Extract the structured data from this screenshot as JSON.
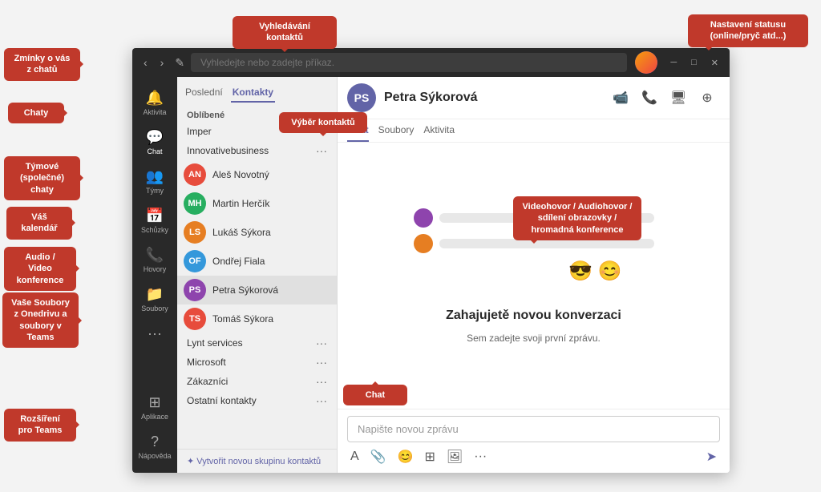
{
  "annotations": {
    "zmínky": "Zmínky o vás z chatů",
    "chaty": "Chaty",
    "tymy": "Týmové (společné) chaty",
    "kalendar": "Váš kalendář",
    "audio": "Audio / Video konference",
    "soubory": "Vaše Soubory z Onedrivu a soubory v Teams",
    "rozsireni": "Rozšíření pro Teams",
    "vyhledavani": "Vyhledávání kontaktů",
    "nastaveni": "Nastavení statusu (online/pryč atd...)",
    "vyber": "Výběr kontaktů",
    "video": "Videohovor / Audiohovor / sdílení obrazovky / hromadná konference",
    "chat_label": "Chat"
  },
  "titlebar": {
    "search_placeholder": "Vyhledejte nebo zadejte příkaz.",
    "nav_back": "‹",
    "nav_forward": "›",
    "compose_icon": "✎"
  },
  "sidebar": {
    "items": [
      {
        "label": "Aktivita",
        "icon": "🔔",
        "active": false
      },
      {
        "label": "Chat",
        "icon": "💬",
        "active": true
      },
      {
        "label": "Týmy",
        "icon": "👥",
        "active": false
      },
      {
        "label": "Schůzky",
        "icon": "📅",
        "active": false
      },
      {
        "label": "Hovory",
        "icon": "📞",
        "active": false
      },
      {
        "label": "Soubory",
        "icon": "📁",
        "active": false
      },
      {
        "label": "···",
        "icon": "···",
        "active": false
      }
    ],
    "bottom_items": [
      {
        "label": "Aplikace",
        "icon": "⊞"
      },
      {
        "label": "Nápověda",
        "icon": "?"
      }
    ]
  },
  "contact_panel": {
    "tabs": [
      "Poslední",
      "Kontakty"
    ],
    "active_tab": "Kontakty",
    "groups": [
      {
        "name": "Oblíbené",
        "has_dots": false,
        "contacts": []
      },
      {
        "name": "Imper",
        "has_dots": true,
        "contacts": []
      },
      {
        "name": "Innovativebusiness",
        "has_dots": true,
        "contacts": [
          {
            "name": "Aleš Novotný",
            "color": "#e74c3c"
          },
          {
            "name": "Martin Herčík",
            "color": "#27ae60"
          },
          {
            "name": "Lukáš Sýkora",
            "color": "#e67e22"
          },
          {
            "name": "Ondřej Fiala",
            "color": "#3498db"
          },
          {
            "name": "Petra Sýkorová",
            "color": "#8e44ad",
            "selected": true
          },
          {
            "name": "Tomáš Sýkora",
            "color": "#e74c3c"
          }
        ]
      },
      {
        "name": "Lynt services",
        "has_dots": true,
        "contacts": []
      },
      {
        "name": "Microsoft",
        "has_dots": true,
        "contacts": []
      },
      {
        "name": "Zákazníci",
        "has_dots": true,
        "contacts": []
      },
      {
        "name": "Ostatní kontakty",
        "has_dots": true,
        "contacts": []
      }
    ],
    "create_group": "✦ Vytvořit novou skupinu kontaktů"
  },
  "chat": {
    "contact_name": "Petra Sýkorová",
    "subtabs": [
      "Chat",
      "Soubory",
      "Aktivita"
    ],
    "active_subtab": "Chat",
    "new_convo_heading": "Zahajujetě novou konverzaci",
    "new_convo_sub": "Sem zadejte svoji první zprávu.",
    "emoji_row": "😎 😊",
    "input_placeholder": "Napište novou zprávu",
    "toolbar": [
      "A",
      "📎",
      "😊",
      "⊞",
      "🖥",
      "···"
    ],
    "send_icon": "➤"
  }
}
